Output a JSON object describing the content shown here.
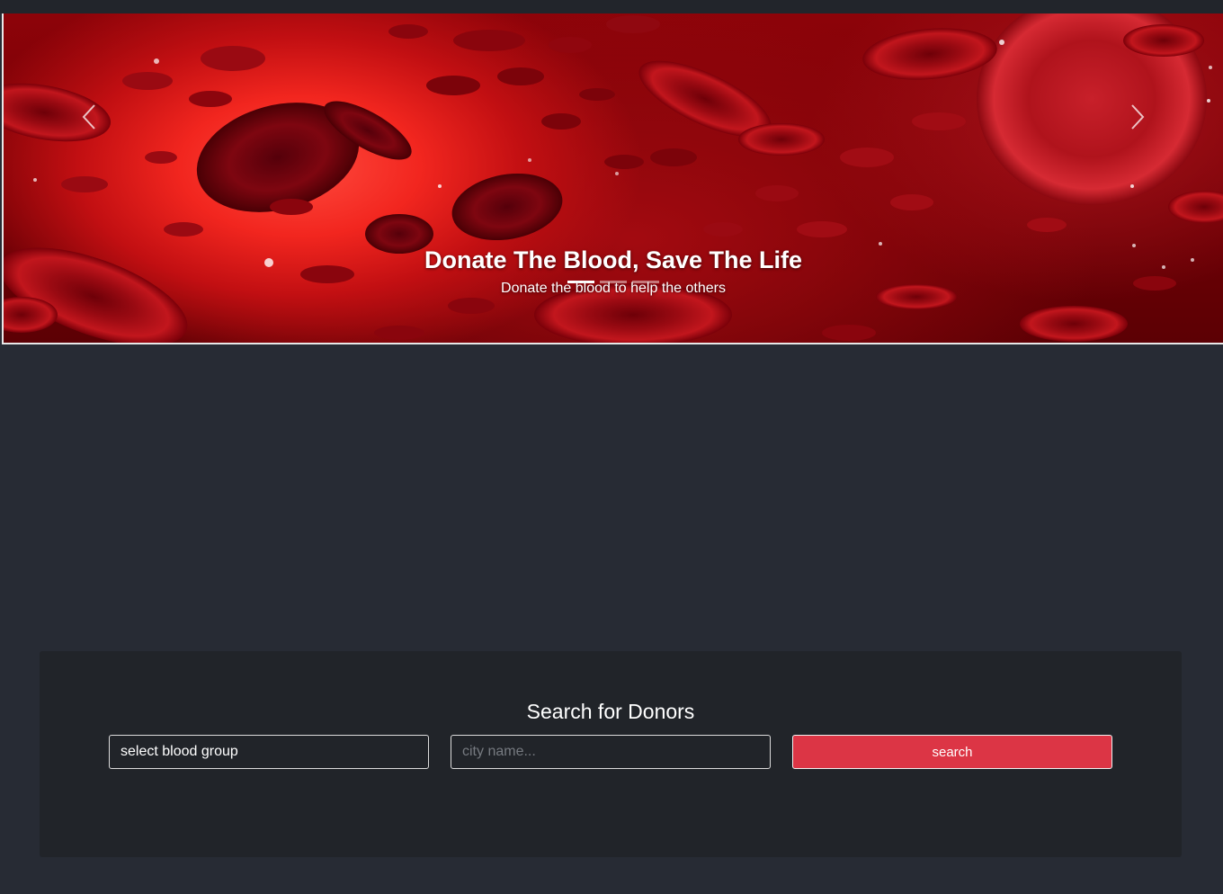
{
  "carousel": {
    "caption_title": "Donate The Blood, Save The Life",
    "caption_subtitle": "Donate the blood to help the others",
    "indicators": [
      {
        "active": true
      },
      {
        "active": false
      },
      {
        "active": false
      }
    ],
    "prev_icon": "chevron-left-icon",
    "next_icon": "chevron-right-icon"
  },
  "search": {
    "title": "Search for Donors",
    "blood_group_value": "select blood group",
    "city_placeholder": "city name...",
    "button_label": "search"
  },
  "colors": {
    "page_background": "#272b34",
    "panel_background": "#212429",
    "accent": "#dc3545"
  }
}
